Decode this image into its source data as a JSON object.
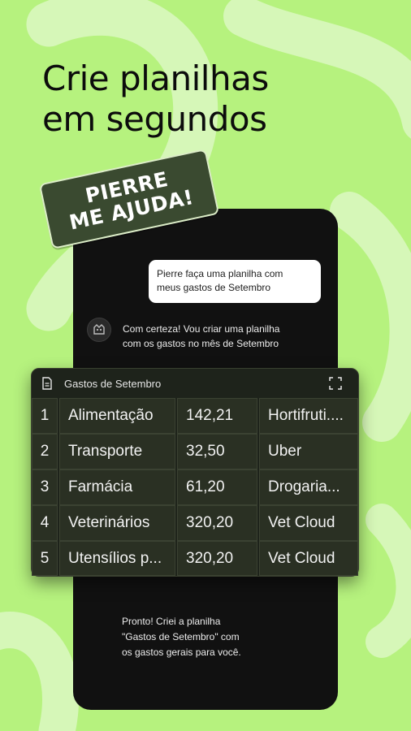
{
  "headline": "Crie planilhas\nem segundos",
  "sticker": {
    "line1": "PIERRE",
    "line2": "ME AJUDA!"
  },
  "chat": {
    "user_message": "Pierre faça uma planilha com\nmeus gastos de Setembro",
    "bot_message": "Com certeza! Vou criar uma planilha\ncom os gastos no mês de Setembro",
    "final_message": "Pronto! Criei a planilha\n\"Gastos de Setembro\" com\nos gastos gerais  para você."
  },
  "sheet": {
    "title": "Gastos de Setembro",
    "rows": [
      {
        "index": "1",
        "category": "Alimentação",
        "value": "142,21",
        "place": "Hortifruti...."
      },
      {
        "index": "2",
        "category": "Transporte",
        "value": "32,50",
        "place": "Uber"
      },
      {
        "index": "3",
        "category": "Farmácia",
        "value": "61,20",
        "place": "Drogaria..."
      },
      {
        "index": "4",
        "category": "Veterinários",
        "value": "320,20",
        "place": "Vet Cloud"
      },
      {
        "index": "5",
        "category": "Utensílios p...",
        "value": "320,20",
        "place": "Vet Cloud"
      }
    ]
  },
  "icons": {
    "avatar": "pierre-avatar-icon",
    "sheet": "document-icon",
    "expand": "expand-icon"
  },
  "colors": {
    "background": "#b6f27e",
    "phone": "#111111",
    "sticker": "#3a4a30",
    "sheet_bg": "#1e231b",
    "cell_bg": "#2a3023"
  }
}
